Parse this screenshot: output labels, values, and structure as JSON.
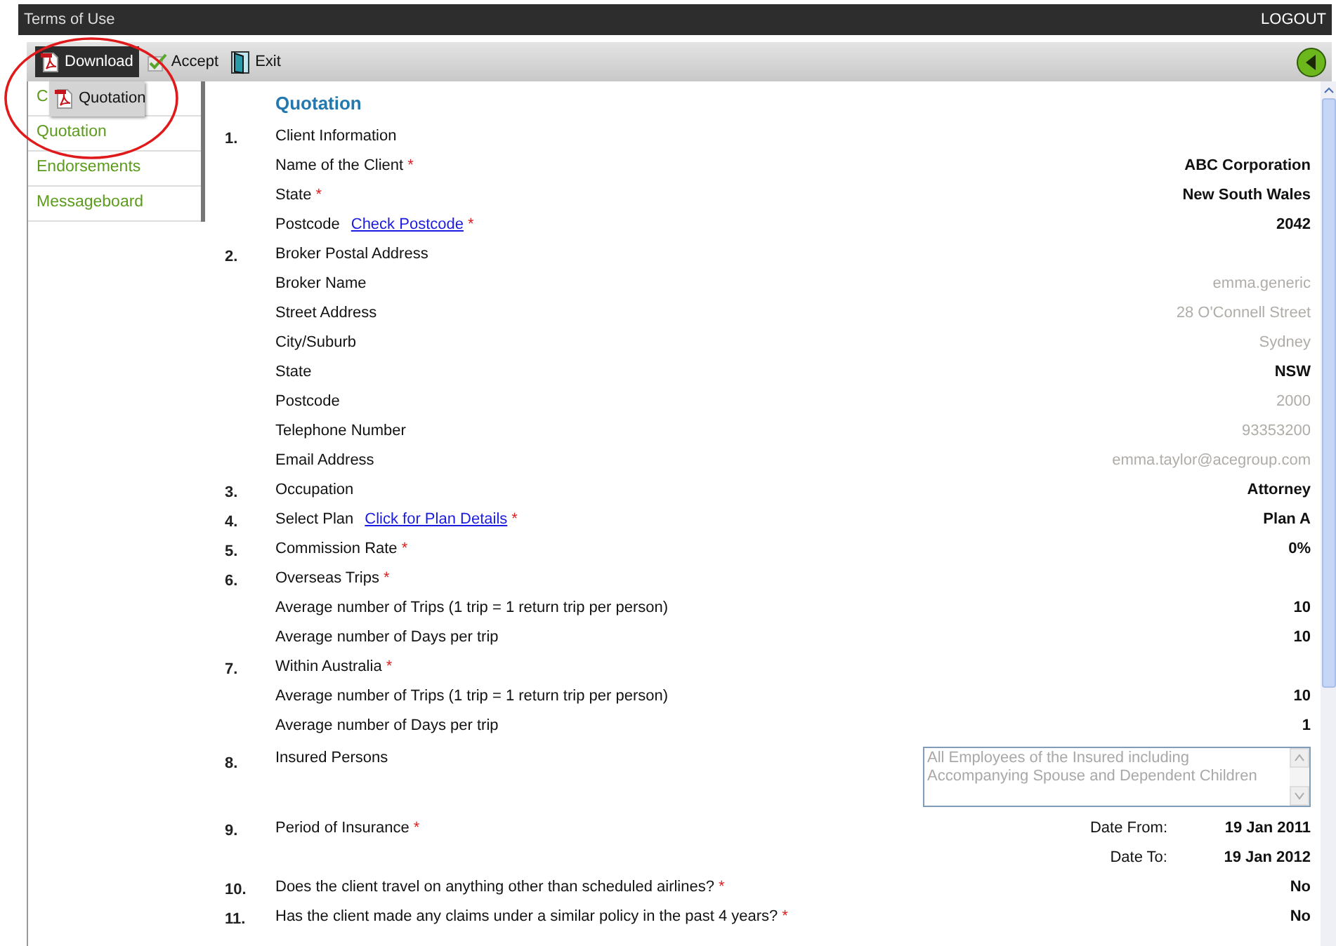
{
  "top_bar": {
    "left_link": "Terms of Use",
    "right_link": "LOGOUT"
  },
  "toolbar": {
    "buttons": [
      {
        "label": "Download",
        "selected": true
      },
      {
        "label": "Accept",
        "selected": false
      },
      {
        "label": "Exit",
        "selected": false
      }
    ]
  },
  "dropdown": {
    "items": [
      {
        "label": "Quotation"
      }
    ]
  },
  "sidebar": {
    "items": [
      {
        "label": "C"
      },
      {
        "label": "Quotation"
      },
      {
        "label": "Endorsements"
      },
      {
        "label": "Messageboard"
      }
    ]
  },
  "form": {
    "title": "Quotation",
    "rows": [
      {
        "kind": "field",
        "number": "1.",
        "label": "Client Information"
      },
      {
        "kind": "field",
        "label": "Name of the Client",
        "required_mark": "*",
        "value": "ABC Corporation",
        "greyed": false
      },
      {
        "kind": "field",
        "label": "State",
        "required_mark": "*",
        "value": "New South Wales",
        "greyed": false
      },
      {
        "kind": "field",
        "label": "Postcode",
        "link": "Check Postcode",
        "required_mark": "*",
        "value": "2042",
        "greyed": false
      },
      {
        "kind": "field",
        "number": "2.",
        "label": "Broker Postal Address"
      },
      {
        "kind": "field",
        "label": "Broker Name",
        "value": "emma.generic",
        "greyed": true
      },
      {
        "kind": "field",
        "label": "Street Address",
        "value": "28 O'Connell Street",
        "greyed": true
      },
      {
        "kind": "field",
        "label": "City/Suburb",
        "value": "Sydney",
        "greyed": true
      },
      {
        "kind": "field",
        "label": "State",
        "value": "NSW",
        "greyed": false
      },
      {
        "kind": "field",
        "label": "Postcode",
        "value": "2000",
        "greyed": true
      },
      {
        "kind": "field",
        "label": "Telephone Number",
        "value": "93353200",
        "greyed": true
      },
      {
        "kind": "field",
        "label": "Email Address",
        "value": "emma.taylor@acegroup.com",
        "greyed": true
      },
      {
        "kind": "field",
        "number": "3.",
        "label": "Occupation",
        "value": "Attorney",
        "greyed": false
      },
      {
        "kind": "field",
        "number": "4.",
        "label": "Select Plan",
        "link": "Click for Plan Details",
        "required_mark": "*",
        "value": "Plan A",
        "greyed": false
      },
      {
        "kind": "field",
        "number": "5.",
        "label": "Commission Rate",
        "required_mark": "*",
        "value": "0%",
        "greyed": false
      },
      {
        "kind": "field",
        "number": "6.",
        "label": "Overseas Trips",
        "required_mark": "*"
      },
      {
        "kind": "field",
        "label": "Average number of Trips (1 trip = 1 return trip per person)",
        "value": "10",
        "greyed": false
      },
      {
        "kind": "field",
        "label": "Average number of Days per trip",
        "value": "10",
        "greyed": false
      },
      {
        "kind": "field",
        "number": "7.",
        "label": "Within Australia",
        "required_mark": "*"
      },
      {
        "kind": "field",
        "label": "Average number of Trips (1 trip = 1 return trip per person)",
        "value": "10",
        "greyed": false
      },
      {
        "kind": "field",
        "label": "Average number of Days per trip",
        "value": "1",
        "greyed": false
      },
      {
        "kind": "textarea",
        "number": "8.",
        "label": "Insured Persons",
        "value": "All Employees of the Insured including Accompanying Spouse and Dependent Children"
      },
      {
        "kind": "date",
        "number": "9.",
        "label": "Period of Insurance",
        "required_mark": "*",
        "date_label": "Date From:",
        "value": "19 Jan 2011"
      },
      {
        "kind": "date",
        "date_label": "Date To:",
        "value": "19 Jan 2012"
      },
      {
        "kind": "field",
        "number": "10.",
        "label": "Does the client travel on anything other than scheduled airlines?",
        "required_mark": "*",
        "value": "No",
        "greyed": false
      },
      {
        "kind": "field",
        "number": "11.",
        "label": "Has the client made any claims under a similar policy in the past 4 years?",
        "required_mark": "*",
        "value": "No",
        "greyed": false
      }
    ]
  }
}
